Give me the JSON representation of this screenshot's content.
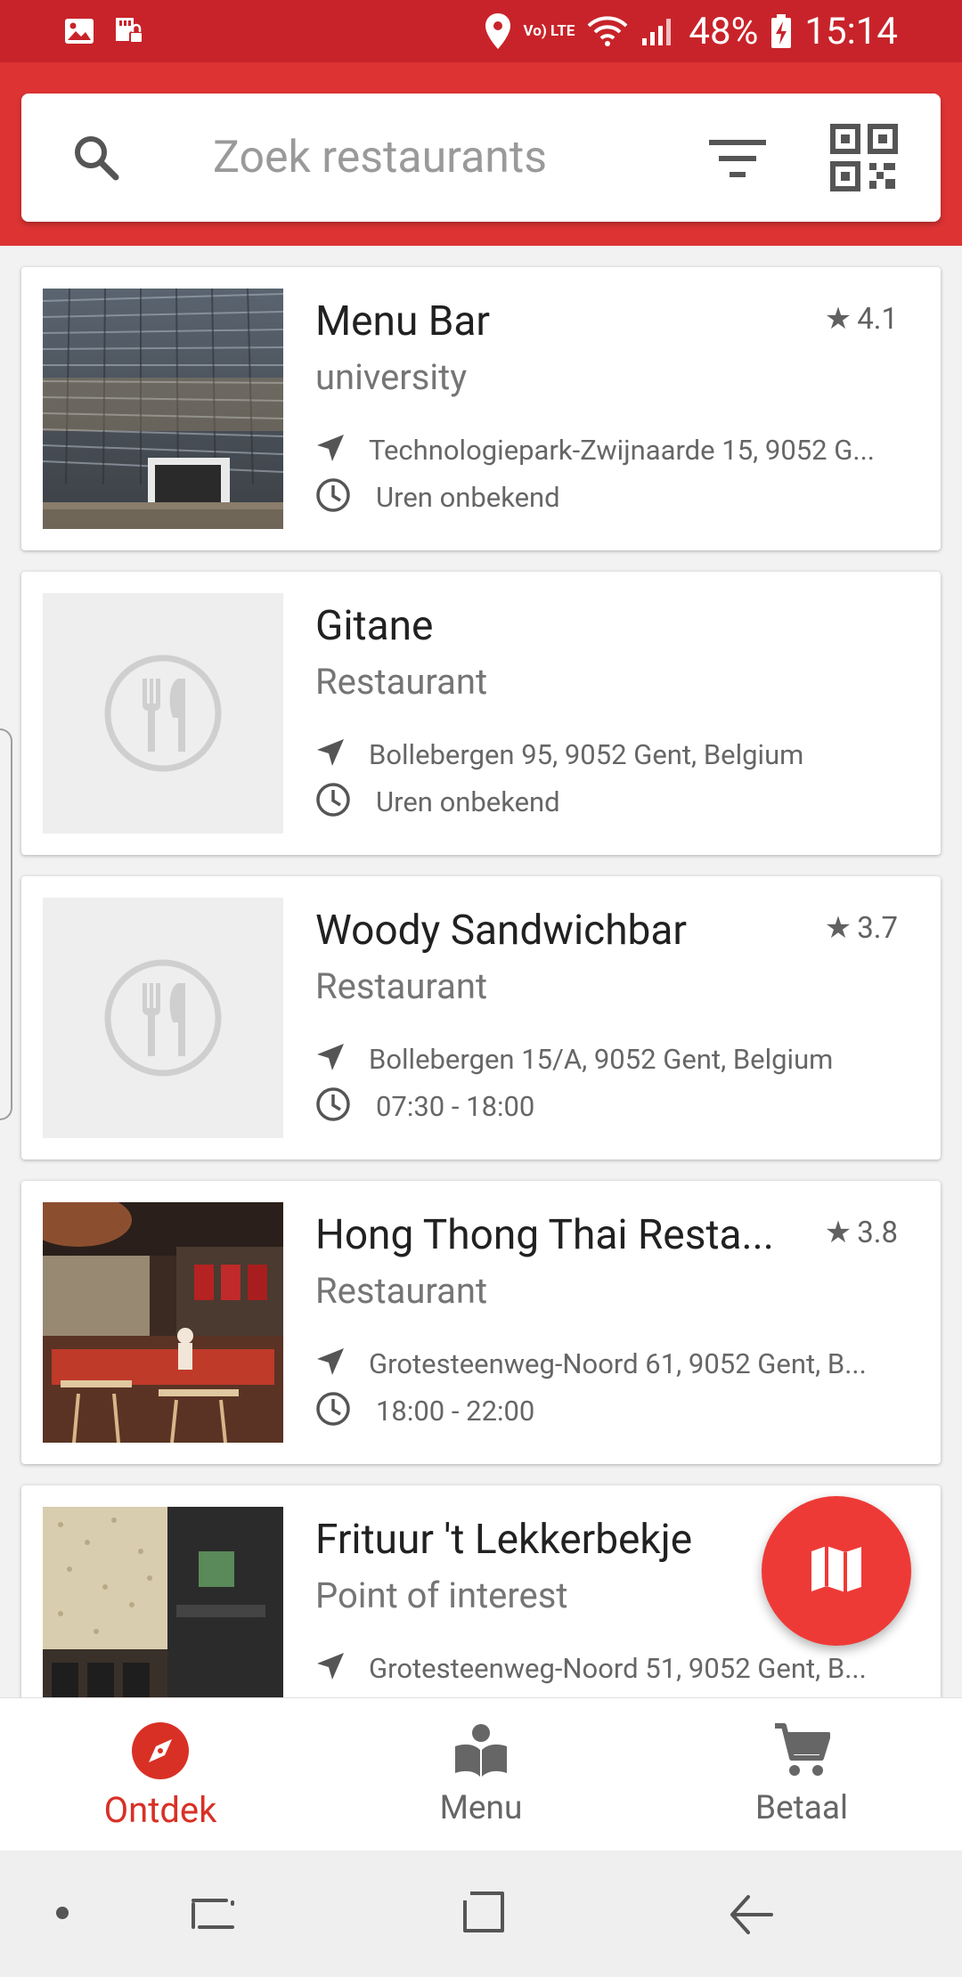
{
  "status_bar": {
    "volte_label": "Vo) LTE",
    "battery": "48%",
    "time": "15:14"
  },
  "search": {
    "placeholder": "Zoek restaurants"
  },
  "restaurants": [
    {
      "name": "Menu Bar",
      "rating": "4.1",
      "type": "university",
      "address": "Technologiepark-Zwijnaarde 15, 9052 G...",
      "hours": "Uren onbekend",
      "image": "building-photo"
    },
    {
      "name": "Gitane",
      "rating": "",
      "type": "Restaurant",
      "address": "Bollebergen 95, 9052 Gent, Belgium",
      "hours": "Uren onbekend",
      "image": "placeholder-cutlery"
    },
    {
      "name": "Woody Sandwichbar",
      "rating": "3.7",
      "type": "Restaurant",
      "address": "Bollebergen 15/A, 9052 Gent, Belgium",
      "hours": "07:30 - 18:00",
      "image": "placeholder-cutlery"
    },
    {
      "name": "Hong Thong Thai Resta...",
      "rating": "3.8",
      "type": "Restaurant",
      "address": "Grotesteenweg-Noord 61, 9052 Gent, B...",
      "hours": "18:00 - 22:00",
      "image": "restaurant-interior-photo"
    },
    {
      "name": "Frituur 't Lekkerbekje",
      "rating": "",
      "type": "Point of interest",
      "address": "Grotesteenweg-Noord 51, 9052 Gent, B...",
      "hours": "",
      "image": "frituur-photo"
    }
  ],
  "bottom_nav": {
    "items": [
      {
        "label": "Ontdek",
        "icon": "compass-icon",
        "active": true
      },
      {
        "label": "Menu",
        "icon": "open-book-icon",
        "active": false
      },
      {
        "label": "Betaal",
        "icon": "shopping-cart-icon",
        "active": false
      }
    ]
  },
  "colors": {
    "status_bar": "#c8232a",
    "toolbar": "#dd3333",
    "accent": "#d93025",
    "fab": "#ee3a36"
  }
}
